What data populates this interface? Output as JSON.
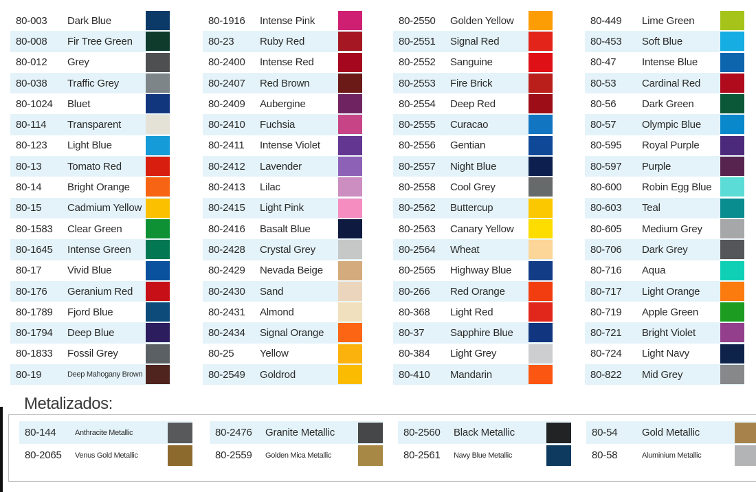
{
  "columns": [
    [
      {
        "code": "80-003",
        "name": "Dark Blue",
        "color": "#0b3a68"
      },
      {
        "code": "80-008",
        "name": "Fir Tree Green",
        "color": "#0e3b2c"
      },
      {
        "code": "80-012",
        "name": "Grey",
        "color": "#4d4f51"
      },
      {
        "code": "80-038",
        "name": "Traffic Grey",
        "color": "#7d8588"
      },
      {
        "code": "80-1024",
        "name": "Bluet",
        "color": "#12367e"
      },
      {
        "code": "80-114",
        "name": "Transparent",
        "color": "#e4e2d7"
      },
      {
        "code": "80-123",
        "name": "Light Blue",
        "color": "#159bd7"
      },
      {
        "code": "80-13",
        "name": "Tomato Red",
        "color": "#d81e0e"
      },
      {
        "code": "80-14",
        "name": "Bright Orange",
        "color": "#f76413"
      },
      {
        "code": "80-15",
        "name": "Cadmium Yellow",
        "color": "#fbc100"
      },
      {
        "code": "80-1583",
        "name": "Clear Green",
        "color": "#0e9135"
      },
      {
        "code": "80-1645",
        "name": "Intense Green",
        "color": "#027752"
      },
      {
        "code": "80-17",
        "name": "Vivid Blue",
        "color": "#0a519e"
      },
      {
        "code": "80-176",
        "name": "Geranium Red",
        "color": "#c70f18"
      },
      {
        "code": "80-1789",
        "name": "Fjord Blue",
        "color": "#0d4c7a"
      },
      {
        "code": "80-1794",
        "name": "Deep Blue",
        "color": "#2b1d5e"
      },
      {
        "code": "80-1833",
        "name": "Fossil Grey",
        "color": "#5b6064"
      },
      {
        "code": "80-19",
        "name": "Deep Mahogany Brown",
        "color": "#4f241e"
      }
    ],
    [
      {
        "code": "80-1916",
        "name": "Intense Pink",
        "color": "#cf1f73"
      },
      {
        "code": "80-23",
        "name": "Ruby Red",
        "color": "#a51722"
      },
      {
        "code": "80-2400",
        "name": "Intense Red",
        "color": "#a5081e"
      },
      {
        "code": "80-2407",
        "name": "Red Brown",
        "color": "#6b1a18"
      },
      {
        "code": "80-2409",
        "name": "Aubergine",
        "color": "#6f2461"
      },
      {
        "code": "80-2410",
        "name": "Fuchsia",
        "color": "#c74586"
      },
      {
        "code": "80-2411",
        "name": "Intense Violet",
        "color": "#633692"
      },
      {
        "code": "80-2412",
        "name": "Lavender",
        "color": "#8d62b6"
      },
      {
        "code": "80-2413",
        "name": "Lilac",
        "color": "#cc8dc1"
      },
      {
        "code": "80-2415",
        "name": "Light Pink",
        "color": "#f58dc1"
      },
      {
        "code": "80-2416",
        "name": "Basalt Blue",
        "color": "#0e1a3f"
      },
      {
        "code": "80-2428",
        "name": "Crystal Grey",
        "color": "#c6c8c8"
      },
      {
        "code": "80-2429",
        "name": "Nevada Beige",
        "color": "#d4ab7d"
      },
      {
        "code": "80-2430",
        "name": "Sand",
        "color": "#ebd6bd"
      },
      {
        "code": "80-2431",
        "name": "Almond",
        "color": "#f1e0be"
      },
      {
        "code": "80-2434",
        "name": "Signal Orange",
        "color": "#fb6514"
      },
      {
        "code": "80-25",
        "name": "Yellow",
        "color": "#fcb20c"
      },
      {
        "code": "80-2549",
        "name": "Goldrod",
        "color": "#fbbb00"
      }
    ],
    [
      {
        "code": "80-2550",
        "name": "Golden Yellow",
        "color": "#fc9d05"
      },
      {
        "code": "80-2551",
        "name": "Signal Red",
        "color": "#e3241b"
      },
      {
        "code": "80-2552",
        "name": "Sanguine",
        "color": "#df1116"
      },
      {
        "code": "80-2553",
        "name": "Fire Brick",
        "color": "#bb1f1b"
      },
      {
        "code": "80-2554",
        "name": "Deep Red",
        "color": "#9d0d17"
      },
      {
        "code": "80-2555",
        "name": "Curacao",
        "color": "#1275c2"
      },
      {
        "code": "80-2556",
        "name": "Gentian",
        "color": "#0e4896"
      },
      {
        "code": "80-2557",
        "name": "Night Blue",
        "color": "#0d1f4f"
      },
      {
        "code": "80-2558",
        "name": "Cool Grey",
        "color": "#666a6b"
      },
      {
        "code": "80-2562",
        "name": "Buttercup",
        "color": "#fbc800"
      },
      {
        "code": "80-2563",
        "name": "Canary Yellow",
        "color": "#fddc00"
      },
      {
        "code": "80-2564",
        "name": "Wheat",
        "color": "#fcd598"
      },
      {
        "code": "80-2565",
        "name": "Highway Blue",
        "color": "#123d86"
      },
      {
        "code": "80-266",
        "name": "Red Orange",
        "color": "#f23d11"
      },
      {
        "code": "80-368",
        "name": "Light Red",
        "color": "#e1261b"
      },
      {
        "code": "80-37",
        "name": "Sapphire Blue",
        "color": "#11367f"
      },
      {
        "code": "80-384",
        "name": "Light Grey",
        "color": "#ccced0"
      },
      {
        "code": "80-410",
        "name": "Mandarin",
        "color": "#fb5713"
      }
    ],
    [
      {
        "code": "80-449",
        "name": "Lime Green",
        "color": "#a6c319"
      },
      {
        "code": "80-453",
        "name": "Soft Blue",
        "color": "#15ade2"
      },
      {
        "code": "80-47",
        "name": "Intense Blue",
        "color": "#0d65ae"
      },
      {
        "code": "80-53",
        "name": "Cardinal Red",
        "color": "#b00a1d"
      },
      {
        "code": "80-56",
        "name": "Dark Green",
        "color": "#0a5838"
      },
      {
        "code": "80-57",
        "name": "Olympic Blue",
        "color": "#0a88cc"
      },
      {
        "code": "80-595",
        "name": "Royal Purple",
        "color": "#4c2a7b"
      },
      {
        "code": "80-597",
        "name": "Purple",
        "color": "#57244f"
      },
      {
        "code": "80-600",
        "name": "Robin Egg Blue",
        "color": "#5cdcd6"
      },
      {
        "code": "80-603",
        "name": "Teal",
        "color": "#0a8d8f"
      },
      {
        "code": "80-605",
        "name": "Medium Grey",
        "color": "#a6a7a8"
      },
      {
        "code": "80-706",
        "name": "Dark Grey",
        "color": "#555659"
      },
      {
        "code": "80-716",
        "name": "Aqua",
        "color": "#0fd0b5"
      },
      {
        "code": "80-717",
        "name": "Light Orange",
        "color": "#fc7b0f"
      },
      {
        "code": "80-719",
        "name": "Apple Green",
        "color": "#1c9c20"
      },
      {
        "code": "80-721",
        "name": "Bright Violet",
        "color": "#943f8c"
      },
      {
        "code": "80-724",
        "name": "Light Navy",
        "color": "#0e234a"
      },
      {
        "code": "80-822",
        "name": "Mid Grey",
        "color": "#87888a"
      }
    ]
  ],
  "metalizados": {
    "title": "Metalizados:",
    "columns": [
      [
        {
          "code": "80-144",
          "name": "Anthracite Metallic",
          "color": "#58595b"
        },
        {
          "code": "80-2065",
          "name": "Venus Gold Metallic",
          "color": "#8c6a2e"
        }
      ],
      [
        {
          "code": "80-2476",
          "name": "Granite Metallic",
          "color": "#464748"
        },
        {
          "code": "80-2559",
          "name": "Golden Mica Metallic",
          "color": "#a88845"
        }
      ],
      [
        {
          "code": "80-2560",
          "name": "Black Metallic",
          "color": "#222324"
        },
        {
          "code": "80-2561",
          "name": "Navy Blue Metallic",
          "color": "#0e3a5f"
        }
      ],
      [
        {
          "code": "80-54",
          "name": "Gold Metallic",
          "color": "#a7834b"
        },
        {
          "code": "80-58",
          "name": "Aluminium Metallic",
          "color": "#b3b4b5"
        }
      ]
    ]
  }
}
